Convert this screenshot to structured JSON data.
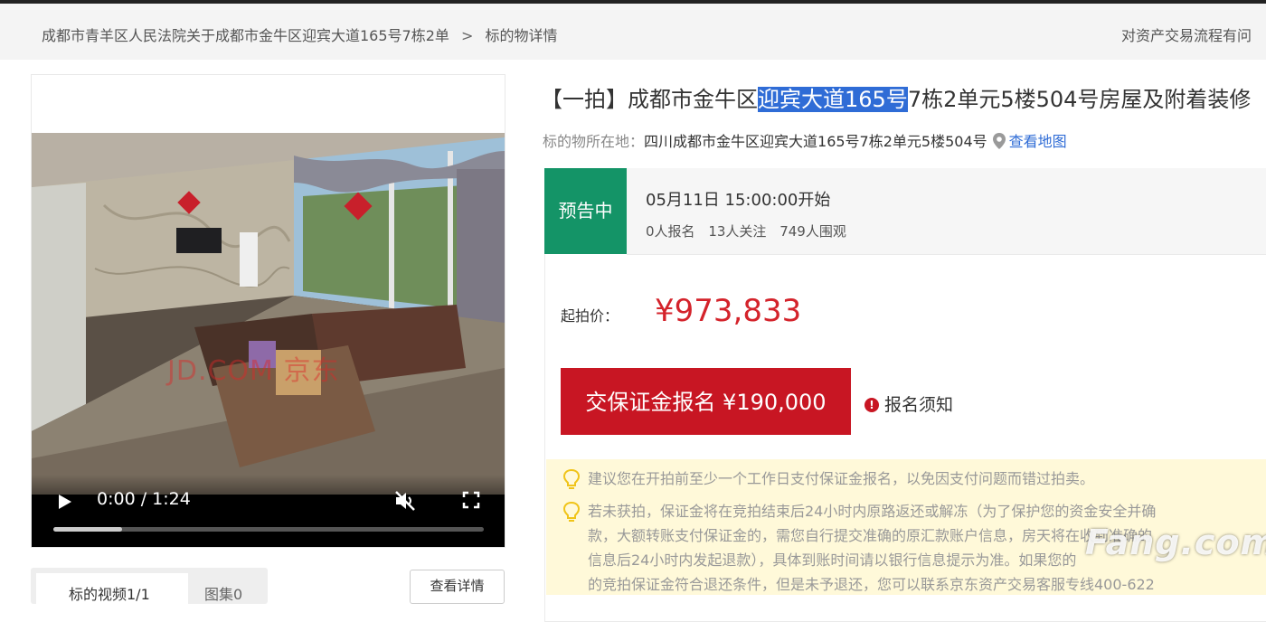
{
  "breadcrumb": {
    "item1": "成都市青羊区人民法院关于成都市金牛区迎宾大道165号7栋2单",
    "sep": ">",
    "item2": "标的物详情",
    "right": "对资产交易流程有问"
  },
  "video": {
    "time": "0:00 / 1:24",
    "watermark": "JD.COM 京东",
    "progress": 0.16
  },
  "media_tabs": {
    "tab1": "标的视频1/1",
    "tab2": "图集0",
    "detail_button": "查看详情"
  },
  "listing": {
    "title_prefix": "【一拍】成都市金牛区",
    "title_highlight": "迎宾大道165号",
    "title_suffix": "7栋2单元5楼504号房屋及附着装修",
    "location_label": "标的物所在地：",
    "location_address": "四川成都市金牛区迎宾大道165号7栋2单元5楼504号",
    "map_link": "查看地图"
  },
  "auction": {
    "status": "预告中",
    "start_time": "05月11日 15:00:00开始",
    "signups": "0人报名",
    "followers": "13人关注",
    "viewers": "749人围观",
    "price_label": "起拍价：",
    "price": "¥973,833",
    "deposit_button": "交保证金报名 ¥190,000",
    "notice_link": "报名须知"
  },
  "tips": {
    "tip1": "建议您在开拍前至少一个工作日支付保证金报名，以免因支付问题而错过拍卖。",
    "tip2_line1": "若未获拍，保证金将在竞拍结束后24小时内原路返还或解冻（为了保护您的资金安全并确",
    "tip2_line2": "款，大额转账支付保证金的，需您自行提交准确的原汇款账户信息，房天将在收到准确的",
    "tip2_line3": "信息后24小时内发起退款），具体到账时间请以银行信息提示为准。如果您的",
    "tip2_line4": "的竞拍保证金符合退还条件，但是未予退还，您可以联系京东资产交易客服专线400-622"
  },
  "site_watermark": "Fang.com",
  "colors": {
    "status_green": "#149467",
    "price_red": "#d4232b",
    "button_red": "#c81623",
    "link_blue": "#2f6cd6",
    "tips_bg": "#fff9d9"
  }
}
